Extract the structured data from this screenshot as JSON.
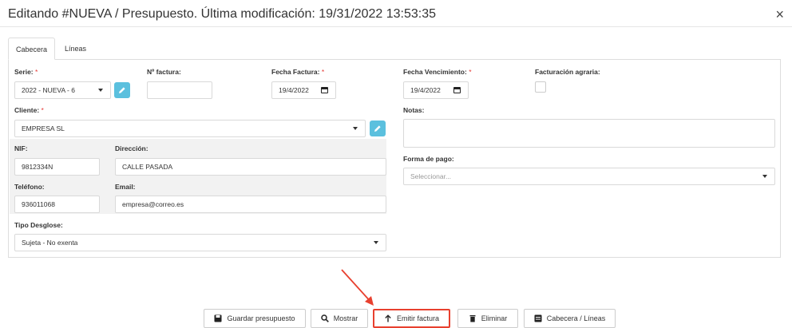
{
  "dialog": {
    "title": "Editando #NUEVA / Presupuesto. Última modificación: 19/31/2022 13:53:35",
    "close_symbol": "×"
  },
  "tabs": [
    {
      "label": "Cabecera",
      "active": true
    },
    {
      "label": "Líneas",
      "active": false
    }
  ],
  "form": {
    "serie": {
      "label": "Serie:",
      "required_mark": "*",
      "value": "2022 - NUEVA - 6"
    },
    "num_factura": {
      "label": "Nº factura:",
      "value": ""
    },
    "fecha_factura": {
      "label": "Fecha Factura:",
      "required_mark": "*",
      "value": "19/4/2022"
    },
    "fecha_vencimiento": {
      "label": "Fecha Vencimiento:",
      "required_mark": "*",
      "value": "19/4/2022"
    },
    "facturacion_agraria": {
      "label": "Facturación agraria:",
      "checked": false
    },
    "cliente": {
      "label": "Cliente:",
      "required_mark": "*",
      "value": "EMPRESA SL"
    },
    "notas": {
      "label": "Notas:",
      "value": ""
    },
    "nif": {
      "label": "NIF:",
      "value": "9812334N"
    },
    "direccion": {
      "label": "Dirección:",
      "value": "CALLE PASADA"
    },
    "forma_pago": {
      "label": "Forma de pago:",
      "placeholder": "Seleccionar..."
    },
    "telefono": {
      "label": "Teléfono:",
      "value": "936011068"
    },
    "email": {
      "label": "Email:",
      "value": "empresa@correo.es"
    },
    "tipo_desglose": {
      "label": "Tipo Desglose:",
      "value": "Sujeta - No exenta"
    }
  },
  "actions": [
    {
      "label": "Guardar presupuesto",
      "icon": "save-icon"
    },
    {
      "label": "Mostrar",
      "icon": "search-icon"
    },
    {
      "label": "Emitir factura",
      "icon": "arrow-up-icon",
      "highlighted": true
    },
    {
      "label": "Eliminar",
      "icon": "trash-icon"
    },
    {
      "label": "Cabecera / Líneas",
      "icon": "list-icon"
    }
  ],
  "colors": {
    "accent": "#5bc0de",
    "required": "#e53935",
    "highlight": "#e8402f"
  }
}
